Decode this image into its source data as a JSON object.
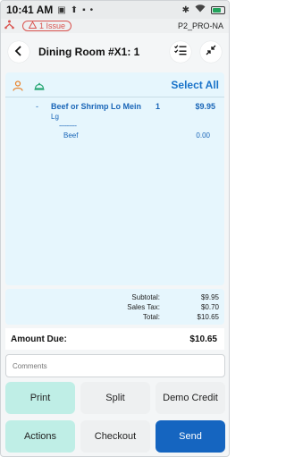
{
  "status": {
    "time": "10:41 AM",
    "battery_level": 0.75
  },
  "issues": {
    "badge": "1 Issue",
    "device": "P2_PRO-NA"
  },
  "header": {
    "title": "Dining Room #X1: 1"
  },
  "order": {
    "select_all": "Select All",
    "item": {
      "dash": "-",
      "name": "Beef or Shrimp Lo Mein",
      "qty": "1",
      "price": "$9.95",
      "size": "Lg",
      "separator": "---------",
      "modifier_name": "Beef",
      "modifier_price": "0.00"
    }
  },
  "totals": {
    "subtotal_label": "Subtotal:",
    "subtotal": "$9.95",
    "tax_label": "Sales Tax:",
    "tax": "$0.70",
    "total_label": "Total:",
    "total": "$10.65",
    "amount_due_label": "Amount Due:",
    "amount_due": "$10.65"
  },
  "comments": {
    "placeholder": "Comments"
  },
  "buttons": {
    "print": "Print",
    "split": "Split",
    "demo_credit": "Demo Credit",
    "actions": "Actions",
    "checkout": "Checkout",
    "send": "Send"
  },
  "colors": {
    "accent": "#1a73c9",
    "send": "#1565c0",
    "teal_button": "#bfeee6",
    "panel": "#e6f6fd",
    "issue": "#d9534f"
  },
  "icons": {
    "back": "chevron-left-icon",
    "checklist": "checklist-icon",
    "collapse": "collapse-icon",
    "person": "person-icon",
    "bell": "service-bell-icon",
    "network": "network-icon",
    "warning": "warning-icon"
  }
}
